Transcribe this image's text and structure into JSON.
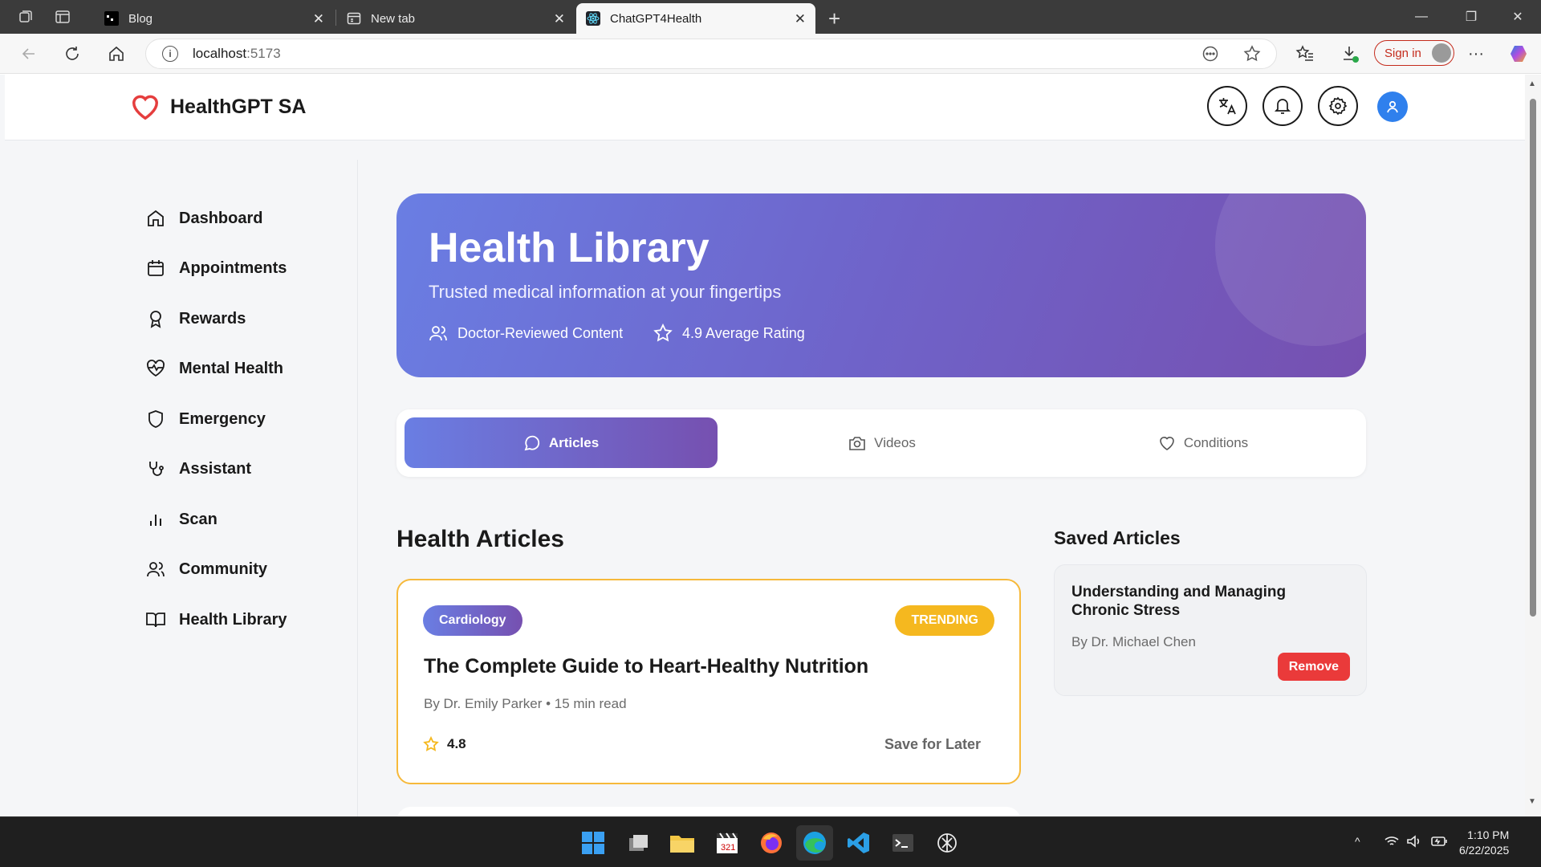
{
  "browser": {
    "tabs": [
      {
        "title": "Blog",
        "active": false
      },
      {
        "title": "New tab",
        "active": false
      },
      {
        "title": "ChatGPT4Health",
        "active": true
      }
    ],
    "url_host": "localhost",
    "url_port": ":5173",
    "sign_in_label": "Sign in"
  },
  "app": {
    "title": "HealthGPT SA",
    "brand_color": "#e53e3e"
  },
  "sidebar": {
    "items": [
      {
        "label": "Dashboard",
        "icon": "home-icon"
      },
      {
        "label": "Appointments",
        "icon": "calendar-icon"
      },
      {
        "label": "Rewards",
        "icon": "award-icon"
      },
      {
        "label": "Mental Health",
        "icon": "heart-pulse-icon"
      },
      {
        "label": "Emergency",
        "icon": "shield-icon"
      },
      {
        "label": "Assistant",
        "icon": "stethoscope-icon"
      },
      {
        "label": "Scan",
        "icon": "bar-chart-icon"
      },
      {
        "label": "Community",
        "icon": "users-icon"
      },
      {
        "label": "Health Library",
        "icon": "book-icon"
      }
    ]
  },
  "hero": {
    "title": "Health Library",
    "subtitle": "Trusted medical information at your fingertips",
    "meta1": "Doctor-Reviewed Content",
    "meta2": "4.9 Average Rating"
  },
  "content_tabs": [
    {
      "label": "Articles",
      "active": true,
      "icon": "message-circle-icon"
    },
    {
      "label": "Videos",
      "active": false,
      "icon": "camera-icon"
    },
    {
      "label": "Conditions",
      "active": false,
      "icon": "heart-icon"
    }
  ],
  "articles_section": {
    "title": "Health Articles",
    "items": [
      {
        "category": "Cardiology",
        "badge": "TRENDING",
        "title": "The Complete Guide to Heart-Healthy Nutrition",
        "byline": "By Dr. Emily Parker • 15 min read",
        "rating": "4.8",
        "save_label": "Save for Later"
      }
    ]
  },
  "saved_section": {
    "title": "Saved Articles",
    "items": [
      {
        "title": "Understanding and Managing Chronic Stress",
        "byline": "By Dr. Michael Chen",
        "remove_label": "Remove"
      }
    ]
  },
  "taskbar": {
    "time": "1:10 PM",
    "date": "6/22/2025"
  }
}
